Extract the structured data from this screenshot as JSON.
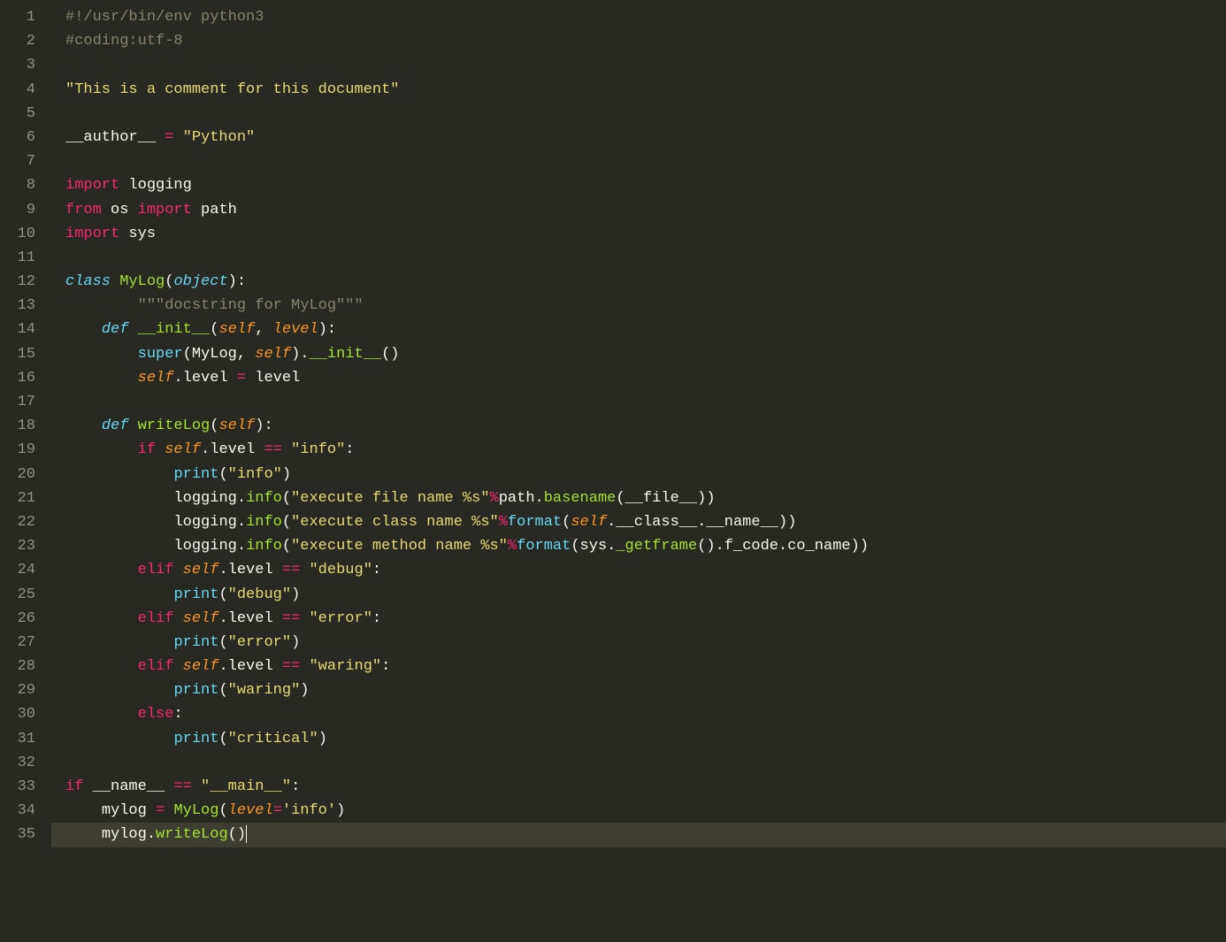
{
  "lineCount": 35,
  "activeLine": 35,
  "lines": {
    "1": [
      [
        "comment",
        "#!/usr/bin/env python3"
      ]
    ],
    "2": [
      [
        "comment",
        "#coding:utf-8"
      ]
    ],
    "3": [],
    "4": [
      [
        "string",
        "\"This is a comment for this document\""
      ]
    ],
    "5": [],
    "6": [
      [
        "ident",
        "__author__ "
      ],
      [
        "op",
        "="
      ],
      [
        "ident",
        " "
      ],
      [
        "string",
        "\"Python\""
      ]
    ],
    "7": [],
    "8": [
      [
        "keyword",
        "import"
      ],
      [
        "ident",
        " logging"
      ]
    ],
    "9": [
      [
        "keyword",
        "from"
      ],
      [
        "ident",
        " os "
      ],
      [
        "keyword",
        "import"
      ],
      [
        "ident",
        " path"
      ]
    ],
    "10": [
      [
        "keyword",
        "import"
      ],
      [
        "ident",
        " sys"
      ]
    ],
    "11": [],
    "12": [
      [
        "kw2",
        "class"
      ],
      [
        "ident",
        " "
      ],
      [
        "classname",
        "MyLog"
      ],
      [
        "punct",
        "("
      ],
      [
        "kw2",
        "object"
      ],
      [
        "punct",
        "):"
      ]
    ],
    "13": [
      [
        "comment",
        "\"\"\"docstring for MyLog\"\"\""
      ]
    ],
    "14": [
      [
        "kw2",
        "def"
      ],
      [
        "ident",
        " "
      ],
      [
        "fn",
        "__init__"
      ],
      [
        "punct",
        "("
      ],
      [
        "param",
        "self"
      ],
      [
        "punct",
        ", "
      ],
      [
        "param",
        "level"
      ],
      [
        "punct",
        "):"
      ]
    ],
    "15": [
      [
        "kw3",
        "super"
      ],
      [
        "punct",
        "(MyLog, "
      ],
      [
        "param",
        "self"
      ],
      [
        "punct",
        ")."
      ],
      [
        "fn",
        "__init__"
      ],
      [
        "punct",
        "()"
      ]
    ],
    "16": [
      [
        "param",
        "self"
      ],
      [
        "punct",
        ".level "
      ],
      [
        "op",
        "="
      ],
      [
        "punct",
        " level"
      ]
    ],
    "17": [],
    "18": [
      [
        "kw2",
        "def"
      ],
      [
        "ident",
        " "
      ],
      [
        "fn",
        "writeLog"
      ],
      [
        "punct",
        "("
      ],
      [
        "param",
        "self"
      ],
      [
        "punct",
        "):"
      ]
    ],
    "19": [
      [
        "keyword",
        "if"
      ],
      [
        "ident",
        " "
      ],
      [
        "param",
        "self"
      ],
      [
        "punct",
        ".level "
      ],
      [
        "op",
        "=="
      ],
      [
        "punct",
        " "
      ],
      [
        "string",
        "\"info\""
      ],
      [
        "punct",
        ":"
      ]
    ],
    "20": [
      [
        "kw3",
        "print"
      ],
      [
        "punct",
        "("
      ],
      [
        "string",
        "\"info\""
      ],
      [
        "punct",
        ")"
      ]
    ],
    "21": [
      [
        "ident",
        "logging."
      ],
      [
        "fn",
        "info"
      ],
      [
        "punct",
        "("
      ],
      [
        "string",
        "\"execute file name %s\""
      ],
      [
        "op",
        "%"
      ],
      [
        "ident",
        "path."
      ],
      [
        "fn",
        "basename"
      ],
      [
        "punct",
        "(__file__))"
      ]
    ],
    "22": [
      [
        "ident",
        "logging."
      ],
      [
        "fn",
        "info"
      ],
      [
        "punct",
        "("
      ],
      [
        "string",
        "\"execute class name %s\""
      ],
      [
        "op",
        "%"
      ],
      [
        "kw3",
        "format"
      ],
      [
        "punct",
        "("
      ],
      [
        "param",
        "self"
      ],
      [
        "punct",
        ".__class__.__name__))"
      ]
    ],
    "23": [
      [
        "ident",
        "logging."
      ],
      [
        "fn",
        "info"
      ],
      [
        "punct",
        "("
      ],
      [
        "string",
        "\"execute method name %s\""
      ],
      [
        "op",
        "%"
      ],
      [
        "kw3",
        "format"
      ],
      [
        "punct",
        "(sys."
      ],
      [
        "fn",
        "_getframe"
      ],
      [
        "punct",
        "().f_code.co_name))"
      ]
    ],
    "24": [
      [
        "keyword",
        "elif"
      ],
      [
        "ident",
        " "
      ],
      [
        "param",
        "self"
      ],
      [
        "punct",
        ".level "
      ],
      [
        "op",
        "=="
      ],
      [
        "punct",
        " "
      ],
      [
        "string",
        "\"debug\""
      ],
      [
        "punct",
        ":"
      ]
    ],
    "25": [
      [
        "kw3",
        "print"
      ],
      [
        "punct",
        "("
      ],
      [
        "string",
        "\"debug\""
      ],
      [
        "punct",
        ")"
      ]
    ],
    "26": [
      [
        "keyword",
        "elif"
      ],
      [
        "ident",
        " "
      ],
      [
        "param",
        "self"
      ],
      [
        "punct",
        ".level "
      ],
      [
        "op",
        "=="
      ],
      [
        "punct",
        " "
      ],
      [
        "string",
        "\"error\""
      ],
      [
        "punct",
        ":"
      ]
    ],
    "27": [
      [
        "kw3",
        "print"
      ],
      [
        "punct",
        "("
      ],
      [
        "string",
        "\"error\""
      ],
      [
        "punct",
        ")"
      ]
    ],
    "28": [
      [
        "keyword",
        "elif"
      ],
      [
        "ident",
        " "
      ],
      [
        "param",
        "self"
      ],
      [
        "punct",
        ".level "
      ],
      [
        "op",
        "=="
      ],
      [
        "punct",
        " "
      ],
      [
        "string",
        "\"waring\""
      ],
      [
        "punct",
        ":"
      ]
    ],
    "29": [
      [
        "kw3",
        "print"
      ],
      [
        "punct",
        "("
      ],
      [
        "string",
        "\"waring\""
      ],
      [
        "punct",
        ")"
      ]
    ],
    "30": [
      [
        "keyword",
        "else"
      ],
      [
        "punct",
        ":"
      ]
    ],
    "31": [
      [
        "kw3",
        "print"
      ],
      [
        "punct",
        "("
      ],
      [
        "string",
        "\"critical\""
      ],
      [
        "punct",
        ")"
      ]
    ],
    "32": [],
    "33": [
      [
        "keyword",
        "if"
      ],
      [
        "ident",
        " __name__ "
      ],
      [
        "op",
        "=="
      ],
      [
        "ident",
        " "
      ],
      [
        "string",
        "\"__main__\""
      ],
      [
        "punct",
        ":"
      ]
    ],
    "34": [
      [
        "ident",
        "mylog "
      ],
      [
        "op",
        "="
      ],
      [
        "ident",
        " "
      ],
      [
        "fn",
        "MyLog"
      ],
      [
        "punct",
        "("
      ],
      [
        "param",
        "level"
      ],
      [
        "op",
        "="
      ],
      [
        "string",
        "'info'"
      ],
      [
        "punct",
        ")"
      ]
    ],
    "35": [
      [
        "ident",
        "mylog."
      ],
      [
        "fn",
        "writeLog"
      ],
      [
        "punct",
        "()"
      ]
    ]
  },
  "indent": {
    "3": 0,
    "4": 0,
    "5": 0,
    "6": 0,
    "7": 0,
    "8": 0,
    "9": 0,
    "10": 0,
    "11": 0,
    "12": 0,
    "13": 2,
    "14": 1,
    "15": 2,
    "16": 2,
    "17": 0,
    "18": 1,
    "19": 2,
    "20": 3,
    "21": 3,
    "22": 3,
    "23": 3,
    "24": 2,
    "25": 3,
    "26": 2,
    "27": 3,
    "28": 2,
    "29": 3,
    "30": 2,
    "31": 3,
    "32": 0,
    "33": 0,
    "34": 1,
    "35": 1
  }
}
